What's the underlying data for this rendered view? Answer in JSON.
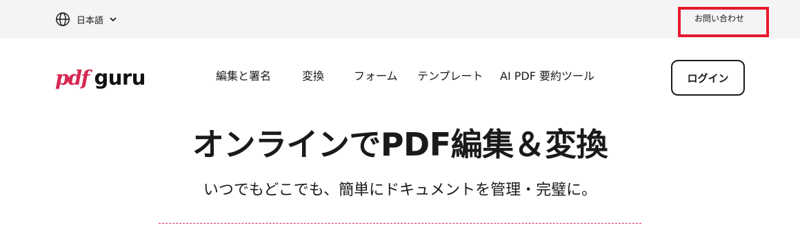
{
  "topbar": {
    "language": {
      "label": "日本語",
      "icon": "globe-icon",
      "dropdown_icon": "chevron-down-icon"
    },
    "contact": {
      "label": "お問い合わせ"
    }
  },
  "header": {
    "logo": {
      "part1": "pdf",
      "part2": "guru"
    },
    "nav": [
      {
        "label": "編集と署名"
      },
      {
        "label": "変換"
      },
      {
        "label": "フォーム"
      },
      {
        "label": "テンプレート"
      },
      {
        "label": "AI PDF 要約ツール"
      }
    ],
    "login": {
      "label": "ログイン"
    }
  },
  "hero": {
    "title": "オンラインでPDF編集＆変換",
    "subtitle": "いつでもどこでも、簡単にドキュメントを管理・完璧に。"
  },
  "colors": {
    "brand": "#d62851",
    "highlight_border": "#e8192c",
    "topbar_bg": "#f4f4f4",
    "text": "#1a1a1a"
  }
}
